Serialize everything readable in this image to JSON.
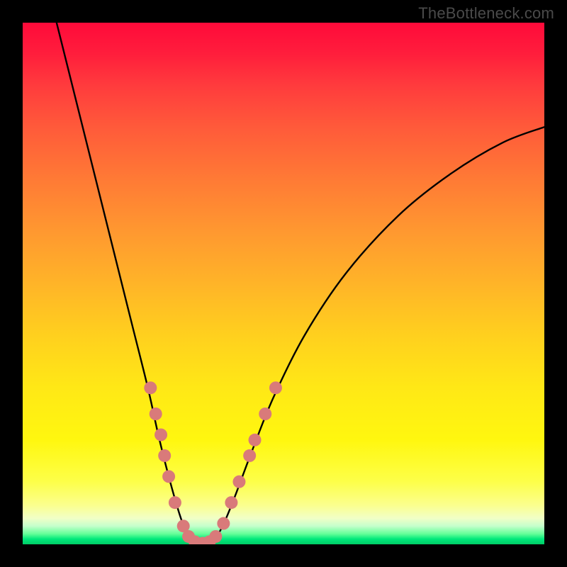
{
  "watermark": "TheBottleneck.com",
  "chart_data": {
    "type": "line",
    "title": "",
    "xlabel": "",
    "ylabel": "",
    "xlim": [
      0,
      100
    ],
    "ylim": [
      0,
      100
    ],
    "curve": {
      "name": "bottleneck-curve",
      "points": [
        {
          "x": 6.5,
          "y": 100
        },
        {
          "x": 10,
          "y": 86
        },
        {
          "x": 14,
          "y": 70
        },
        {
          "x": 18,
          "y": 54
        },
        {
          "x": 21,
          "y": 42
        },
        {
          "x": 24,
          "y": 30
        },
        {
          "x": 26,
          "y": 21
        },
        {
          "x": 28,
          "y": 13
        },
        {
          "x": 30,
          "y": 6
        },
        {
          "x": 31.5,
          "y": 2
        },
        {
          "x": 33,
          "y": 0.5
        },
        {
          "x": 34.5,
          "y": 0
        },
        {
          "x": 36,
          "y": 0.5
        },
        {
          "x": 37.5,
          "y": 2
        },
        {
          "x": 39,
          "y": 5
        },
        {
          "x": 41,
          "y": 10
        },
        {
          "x": 44,
          "y": 18
        },
        {
          "x": 48,
          "y": 28
        },
        {
          "x": 54,
          "y": 40
        },
        {
          "x": 62,
          "y": 52
        },
        {
          "x": 72,
          "y": 63
        },
        {
          "x": 82,
          "y": 71
        },
        {
          "x": 92,
          "y": 77
        },
        {
          "x": 100,
          "y": 80
        }
      ]
    },
    "markers": {
      "name": "highlighted-points",
      "color": "#d97a7a",
      "points": [
        {
          "x": 24.5,
          "y": 30
        },
        {
          "x": 25.5,
          "y": 25
        },
        {
          "x": 26.5,
          "y": 21
        },
        {
          "x": 27.2,
          "y": 17
        },
        {
          "x": 28.0,
          "y": 13
        },
        {
          "x": 29.2,
          "y": 8
        },
        {
          "x": 30.8,
          "y": 3.5
        },
        {
          "x": 31.8,
          "y": 1.5
        },
        {
          "x": 33.0,
          "y": 0.5
        },
        {
          "x": 34.5,
          "y": 0.2
        },
        {
          "x": 35.8,
          "y": 0.5
        },
        {
          "x": 37.0,
          "y": 1.5
        },
        {
          "x": 38.5,
          "y": 4
        },
        {
          "x": 40.0,
          "y": 8
        },
        {
          "x": 41.5,
          "y": 12
        },
        {
          "x": 43.5,
          "y": 17
        },
        {
          "x": 44.5,
          "y": 20
        },
        {
          "x": 46.5,
          "y": 25
        },
        {
          "x": 48.5,
          "y": 30
        }
      ]
    },
    "gradient_stops": [
      {
        "pos": 0,
        "color": "#ff0a3a"
      },
      {
        "pos": 20,
        "color": "#ff5a3a"
      },
      {
        "pos": 50,
        "color": "#ffb428"
      },
      {
        "pos": 80,
        "color": "#fff70f"
      },
      {
        "pos": 95,
        "color": "#f1ffc6"
      },
      {
        "pos": 100,
        "color": "#00cc66"
      }
    ]
  }
}
